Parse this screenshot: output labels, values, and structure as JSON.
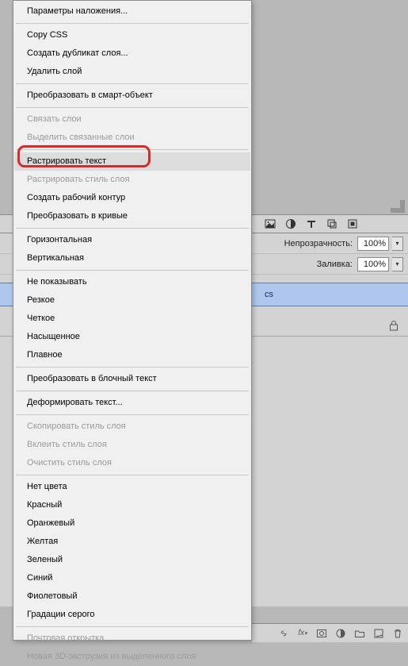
{
  "panel": {
    "opacity_label": "Непрозрачность:",
    "opacity_value": "100%",
    "fill_label": "Заливка:",
    "fill_value": "100%",
    "layer_suffix": "cs"
  },
  "menu": {
    "items": [
      {
        "type": "item",
        "label": "Параметры наложения...",
        "enabled": true
      },
      {
        "type": "sep"
      },
      {
        "type": "item",
        "label": "Copy CSS",
        "enabled": true
      },
      {
        "type": "item",
        "label": "Создать дубликат слоя...",
        "enabled": true
      },
      {
        "type": "item",
        "label": "Удалить слой",
        "enabled": true
      },
      {
        "type": "sep"
      },
      {
        "type": "item",
        "label": "Преобразовать в смарт-объект",
        "enabled": true
      },
      {
        "type": "sep"
      },
      {
        "type": "item",
        "label": "Связать слои",
        "enabled": false
      },
      {
        "type": "item",
        "label": "Выделить связанные слои",
        "enabled": false
      },
      {
        "type": "sep"
      },
      {
        "type": "item",
        "label": "Растрировать текст",
        "enabled": true,
        "highlight": true
      },
      {
        "type": "item",
        "label": "Растрировать стиль слоя",
        "enabled": false
      },
      {
        "type": "item",
        "label": "Создать рабочий контур",
        "enabled": true
      },
      {
        "type": "item",
        "label": "Преобразовать в кривые",
        "enabled": true
      },
      {
        "type": "sep"
      },
      {
        "type": "item",
        "label": "Горизонтальная",
        "enabled": true
      },
      {
        "type": "item",
        "label": "Вертикальная",
        "enabled": true
      },
      {
        "type": "sep"
      },
      {
        "type": "item",
        "label": "Не показывать",
        "enabled": true
      },
      {
        "type": "item",
        "label": "Резкое",
        "enabled": true
      },
      {
        "type": "item",
        "label": "Четкое",
        "enabled": true
      },
      {
        "type": "item",
        "label": "Насыщенное",
        "enabled": true
      },
      {
        "type": "item",
        "label": "Плавное",
        "enabled": true
      },
      {
        "type": "sep"
      },
      {
        "type": "item",
        "label": "Преобразовать в блочный текст",
        "enabled": true
      },
      {
        "type": "sep"
      },
      {
        "type": "item",
        "label": "Деформировать текст...",
        "enabled": true
      },
      {
        "type": "sep"
      },
      {
        "type": "item",
        "label": "Скопировать стиль слоя",
        "enabled": false
      },
      {
        "type": "item",
        "label": "Вклеить стиль слоя",
        "enabled": false
      },
      {
        "type": "item",
        "label": "Очистить стиль слоя",
        "enabled": false
      },
      {
        "type": "sep"
      },
      {
        "type": "item",
        "label": "Нет цвета",
        "enabled": true
      },
      {
        "type": "item",
        "label": "Красный",
        "enabled": true
      },
      {
        "type": "item",
        "label": "Оранжевый",
        "enabled": true
      },
      {
        "type": "item",
        "label": "Желтая",
        "enabled": true
      },
      {
        "type": "item",
        "label": "Зеленый",
        "enabled": true
      },
      {
        "type": "item",
        "label": "Синий",
        "enabled": true
      },
      {
        "type": "item",
        "label": "Фиолетовый",
        "enabled": true
      },
      {
        "type": "item",
        "label": "Градации серого",
        "enabled": true
      },
      {
        "type": "sep"
      },
      {
        "type": "item",
        "label": "Почтовая открытка",
        "enabled": false
      },
      {
        "type": "item",
        "label": "Новая 3D-экструзия из выделенного слоя",
        "enabled": false
      }
    ]
  }
}
